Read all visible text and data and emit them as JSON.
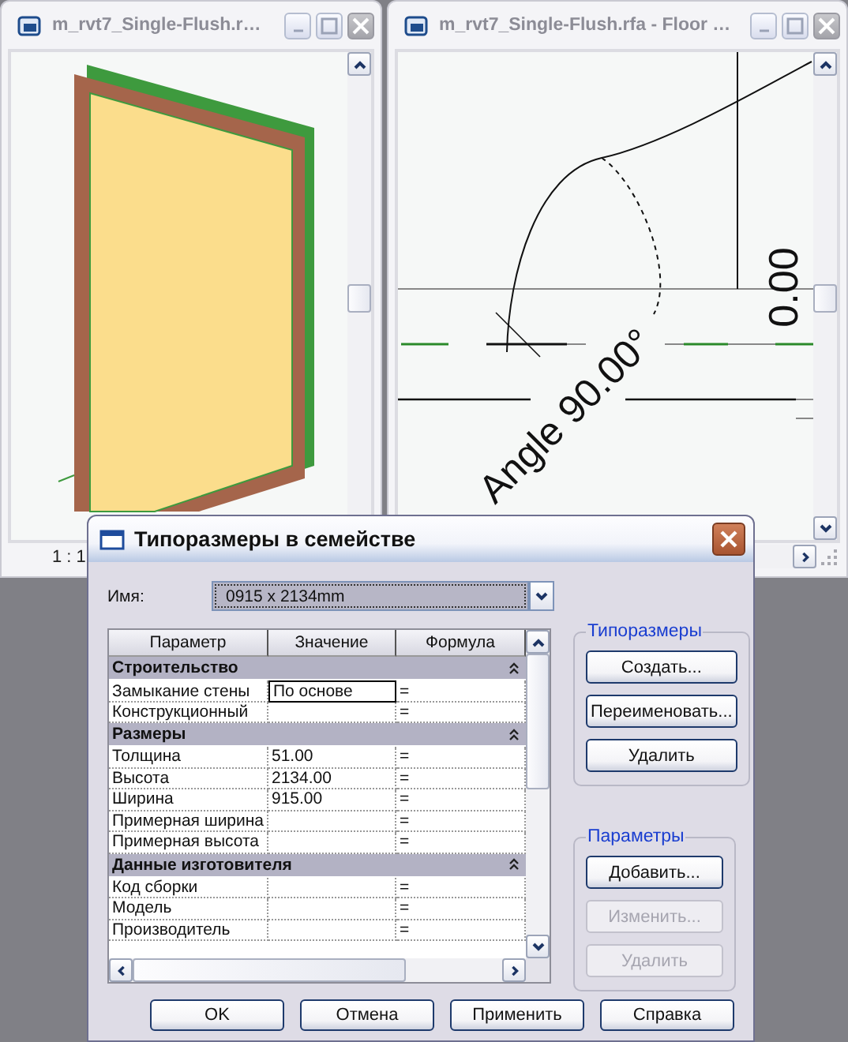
{
  "views": [
    {
      "title": "m_rvt7_Single-Flush.r…",
      "kind": "perspective",
      "scale": "1 : 1"
    },
    {
      "title": "m_rvt7_Single-Flush.rfa - Floor …",
      "kind": "plan",
      "labels": [
        "Angle 90.00°",
        "0.00"
      ]
    }
  ],
  "dialog": {
    "title": "Типоразмеры в семействе",
    "name_label": "Имя:",
    "name_value": "0915 x 2134mm",
    "columns": [
      "Параметр",
      "Значение",
      "Формула"
    ],
    "groups": [
      {
        "title": "Строительство",
        "expanded": true,
        "rows": [
          {
            "parameter": "Замыкание стены",
            "value": "По основе",
            "formula": "=",
            "editing": true
          },
          {
            "parameter": "Конструкционный",
            "value": "",
            "formula": "=",
            "editing": false
          }
        ]
      },
      {
        "title": "Размеры",
        "expanded": true,
        "rows": [
          {
            "parameter": "Толщина",
            "value": "51.00",
            "formula": "=",
            "editing": false
          },
          {
            "parameter": "Высота",
            "value": "2134.00",
            "formula": "=",
            "editing": false
          },
          {
            "parameter": "Ширина",
            "value": "915.00",
            "formula": "=",
            "editing": false
          },
          {
            "parameter": "Примерная ширина",
            "value": "",
            "formula": "=",
            "editing": false
          },
          {
            "parameter": "Примерная высота",
            "value": "",
            "formula": "=",
            "editing": false
          }
        ]
      },
      {
        "title": "Данные изготовителя",
        "expanded": true,
        "rows": [
          {
            "parameter": "Код сборки",
            "value": "",
            "formula": "=",
            "editing": false
          },
          {
            "parameter": "Модель",
            "value": "",
            "formula": "=",
            "editing": false
          },
          {
            "parameter": "Производитель",
            "value": "",
            "formula": "=",
            "editing": false
          }
        ]
      }
    ],
    "side_groups": [
      {
        "title": "Типоразмеры",
        "buttons": [
          {
            "label": "Создать...",
            "disabled": false
          },
          {
            "label": "Переименовать...",
            "disabled": false
          },
          {
            "label": "Удалить",
            "disabled": false
          }
        ]
      },
      {
        "title": "Параметры",
        "buttons": [
          {
            "label": "Добавить...",
            "disabled": false
          },
          {
            "label": "Изменить...",
            "disabled": true
          },
          {
            "label": "Удалить",
            "disabled": true
          }
        ]
      }
    ],
    "buttons": [
      "OK",
      "Отмена",
      "Применить",
      "Справка"
    ]
  }
}
